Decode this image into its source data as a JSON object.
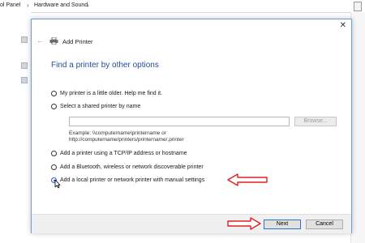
{
  "background": {
    "breadcrumb": [
      "ol Panel",
      "Hardware and Sound"
    ],
    "breadcrumb_separator": "›"
  },
  "dialog": {
    "title": "Add Printer",
    "close_glyph": "✕",
    "back_glyph": "←",
    "heading": "Find a printer by other options",
    "options": [
      {
        "label": "My printer is a little older. Help me find it.",
        "selected": false
      },
      {
        "label": "Select a shared printer by name",
        "selected": false
      },
      {
        "label": "Add a printer using a TCP/IP address or hostname",
        "selected": false
      },
      {
        "label": "Add a Bluetooth, wireless or network discoverable printer",
        "selected": false
      },
      {
        "label": "Add a local printer or network printer with manual settings",
        "selected": true
      }
    ],
    "shared_printer_value": "",
    "browse_label": "Browse...",
    "example_line1": "Example: \\\\computername\\printername or",
    "example_line2": "http://computername/printers/printername/.printer",
    "next_label": "Next",
    "cancel_label": "Cancel"
  },
  "colors": {
    "heading": "#1f4e9c",
    "annotation_arrow": "#e02020",
    "dialog_border": "#6aa0d8"
  }
}
